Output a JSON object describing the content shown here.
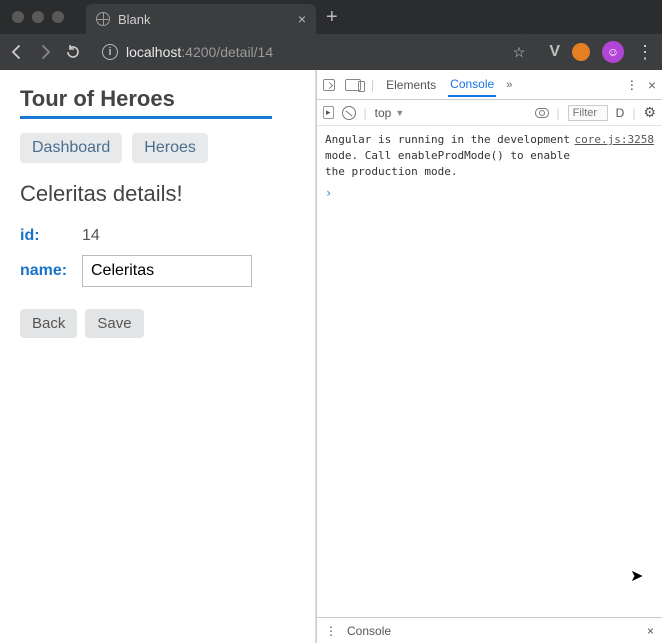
{
  "browser": {
    "tab_title": "Blank",
    "new_tab_glyph": "+",
    "tab_close_glyph": "×",
    "url_host": "localhost",
    "url_portpath": ":4200/detail/14",
    "info_glyph": "i",
    "star_glyph": "☆",
    "v_glyph": "V",
    "menu_glyph": "⋮",
    "avatar_glyph": "☺"
  },
  "app": {
    "title": "Tour of Heroes",
    "nav": {
      "dashboard": "Dashboard",
      "heroes": "Heroes"
    },
    "details_heading": "Celeritas details!",
    "id_label": "id:",
    "id_value": "14",
    "name_label": "name:",
    "name_value": "Celeritas",
    "back_label": "Back",
    "save_label": "Save"
  },
  "devtools": {
    "tabs": {
      "elements": "Elements",
      "console": "Console"
    },
    "more_glyph": "»",
    "menu_glyph": "⋮",
    "close_glyph": "×",
    "context": "top",
    "context_arrow": "▼",
    "filter_placeholder": "Filter",
    "levels_short": "D",
    "gear_glyph": "⚙",
    "play_glyph": "▸",
    "log_message": "Angular is running in the development mode. Call enableProdMode() to enable the production mode.",
    "log_source": "core.js:3258",
    "prompt_glyph": "›",
    "footer_label": "Console",
    "footer_close": "×"
  }
}
